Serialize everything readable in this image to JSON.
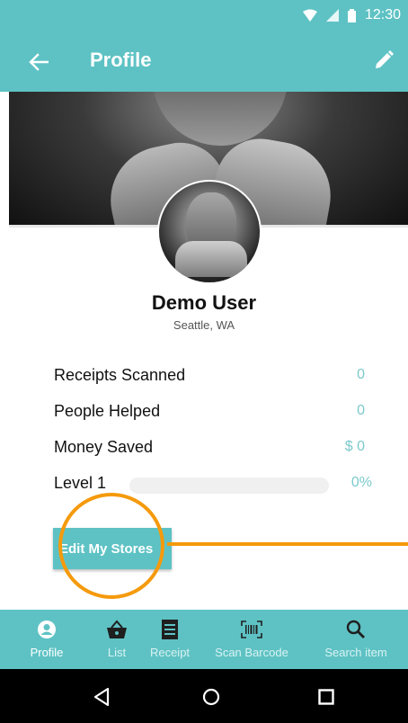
{
  "status_bar": {
    "time": "12:30"
  },
  "app_bar": {
    "title": "Profile"
  },
  "profile": {
    "name": "Demo User",
    "location": "Seattle, WA"
  },
  "stats": [
    {
      "label": "Receipts Scanned",
      "value": "0"
    },
    {
      "label": "People Helped",
      "value": "0"
    },
    {
      "label": "Money Saved",
      "value": "$ 0"
    }
  ],
  "level": {
    "label": "Level 1",
    "progress_text": "0%",
    "progress_fraction": 0
  },
  "edit_stores_button": "Edit My Stores",
  "bottom_nav": [
    {
      "label": "Profile",
      "icon": "account-circle-icon",
      "active": true
    },
    {
      "label": "List",
      "icon": "basket-icon"
    },
    {
      "label": "Receipt",
      "icon": "receipt-icon"
    },
    {
      "label": "Scan Barcode",
      "icon": "barcode-scan-icon"
    },
    {
      "label": "Search item",
      "icon": "search-icon"
    }
  ],
  "colors": {
    "primary": "#5ec2c4",
    "accent_text": "#7cc9cc",
    "annotation": "#f59a0c"
  }
}
